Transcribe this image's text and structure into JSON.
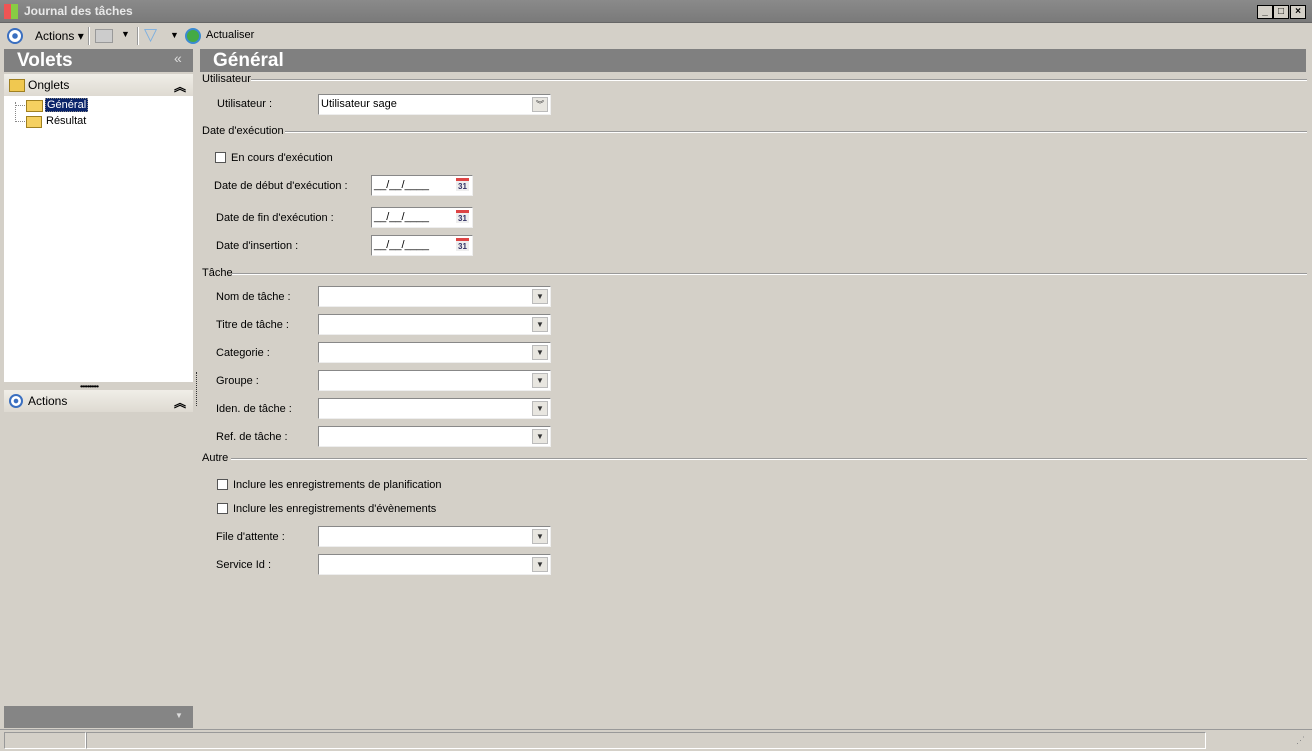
{
  "window": {
    "title": "Journal des tâches",
    "min": "_",
    "max": "□",
    "close": "×"
  },
  "toolbar": {
    "actions": "Actions",
    "refresh": "Actualiser"
  },
  "sidebar": {
    "title": "Volets",
    "collapse": "«",
    "tabs_header": "Onglets",
    "tree": [
      {
        "label": "Général",
        "selected": true
      },
      {
        "label": "Résultat"
      }
    ],
    "actions_header": "Actions",
    "chev": "⌃"
  },
  "main": {
    "title": "Général",
    "sections": {
      "user": "Utilisateur",
      "date": "Date d'exécution",
      "task": "Tâche",
      "other": "Autre"
    },
    "user_label": "Utilisateur :",
    "user_value": "Utilisateur sage",
    "running": "En cours d'exécution",
    "dates": [
      {
        "label": "Date de début d'exécution  :",
        "value": "__/__/____"
      },
      {
        "label": "Date de fin d'exécution :",
        "value": "__/__/____"
      },
      {
        "label": "Date d'insertion :",
        "value": "__/__/____"
      }
    ],
    "task_fields": [
      {
        "label": "Nom de tâche :",
        "value": ""
      },
      {
        "label": "Titre de tâche :",
        "value": ""
      },
      {
        "label": "Categorie :",
        "value": ""
      },
      {
        "label": "Groupe :",
        "value": ""
      },
      {
        "label": "Iden. de tâche :",
        "value": ""
      },
      {
        "label": "Ref. de tâche :",
        "value": ""
      }
    ],
    "include_planning": "Inclure les enregistrements de planification",
    "include_events": "Inclure les enregistrements d'évènements",
    "other_fields": [
      {
        "label": "File d'attente :",
        "value": ""
      },
      {
        "label": "Service Id :",
        "value": ""
      }
    ]
  }
}
